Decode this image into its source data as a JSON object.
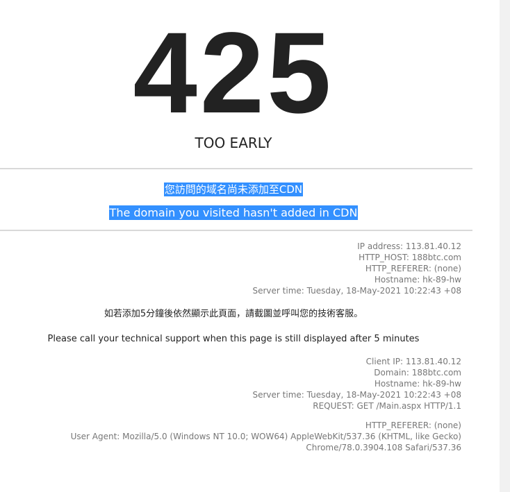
{
  "error": {
    "code": "425",
    "status": "TOO EARLY"
  },
  "message": {
    "chinese": "您訪問的域名尚未添加至CDN",
    "english": "The domain you visited hasn't added in CDN"
  },
  "server_info": {
    "ip_address": "IP address: 113.81.40.12",
    "http_host": "HTTP_HOST: 188btc.com",
    "http_referer": "HTTP_REFERER: (none)",
    "hostname": "Hostname: hk-89-hw",
    "server_time": "Server time: Tuesday, 18-May-2021 10:22:43 +08"
  },
  "support_note": {
    "chinese": "如若添加5分鐘後依然顯示此頁面，請截圖並呼叫您的技術客服。",
    "english": "Please call your technical support when this page is still displayed after 5 minutes"
  },
  "client_info": {
    "client_ip": "Client IP: 113.81.40.12",
    "domain": "Domain: 188btc.com",
    "hostname": "Hostname: hk-89-hw",
    "server_time": "Server time: Tuesday, 18-May-2021 10:22:43 +08",
    "request": "REQUEST: GET /Main.aspx HTTP/1.1"
  },
  "request_headers": {
    "http_referer": "HTTP_REFERER: (none)",
    "user_agent_line1": "User Agent: Mozilla/5.0 (Windows NT 10.0; WOW64) AppleWebKit/537.36 (KHTML, like Gecko)",
    "user_agent_line2": "Chrome/78.0.3904.108 Safari/537.36"
  }
}
